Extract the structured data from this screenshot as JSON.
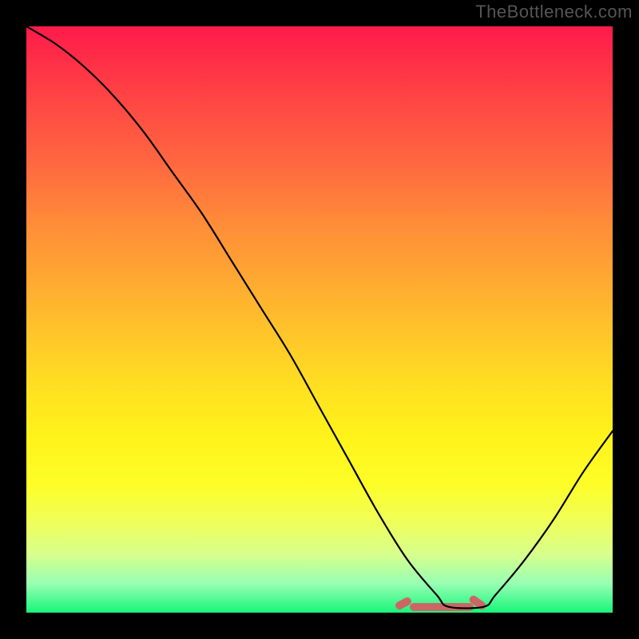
{
  "watermark": "TheBottleneck.com",
  "chart_data": {
    "type": "line",
    "title": "",
    "xlabel": "",
    "ylabel": "",
    "xlim": [
      0,
      100
    ],
    "ylim": [
      0,
      100
    ],
    "series": [
      {
        "name": "bottleneck-curve",
        "x": [
          0,
          5,
          10,
          15,
          20,
          25,
          30,
          35,
          40,
          45,
          50,
          55,
          60,
          65,
          70,
          72,
          78,
          80,
          85,
          90,
          95,
          100
        ],
        "y": [
          100,
          97,
          93,
          88,
          82,
          75,
          68,
          60,
          52,
          44,
          35,
          26,
          17,
          9,
          3,
          1,
          1,
          3,
          9,
          16,
          24,
          31
        ]
      }
    ],
    "highlight_band": {
      "x_start": 65,
      "x_end": 80,
      "color": "#cc6666"
    },
    "background_gradient": {
      "top": "#ff1a4b",
      "mid": "#ffe121",
      "bottom": "#18f57a"
    }
  }
}
